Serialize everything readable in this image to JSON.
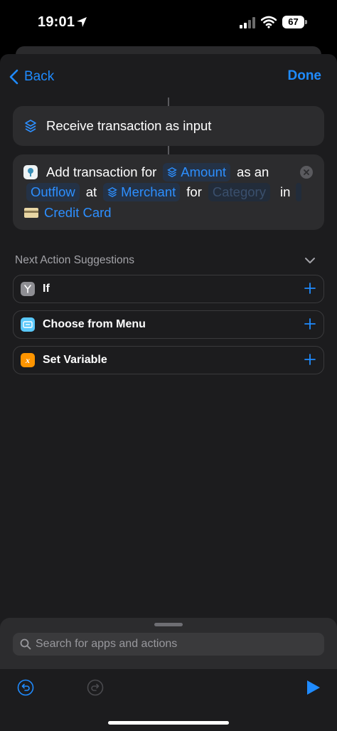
{
  "status": {
    "time": "19:01",
    "battery": "67"
  },
  "nav": {
    "back": "Back",
    "done": "Done"
  },
  "actions": {
    "receive": "Receive transaction as input",
    "add": {
      "w1": "Add transaction for",
      "amount": "Amount",
      "w2": "as an",
      "outflow": "Outflow",
      "w3": "at",
      "merchant": "Merchant",
      "w4": "for",
      "category": "Category",
      "w5": "in",
      "account": "Credit Card"
    }
  },
  "suggestions": {
    "title": "Next Action Suggestions",
    "items": [
      {
        "label": "If",
        "icon": "if-icon",
        "color": "#8e8e93"
      },
      {
        "label": "Choose from Menu",
        "icon": "menu-icon",
        "color": "#5ac8fa"
      },
      {
        "label": "Set Variable",
        "icon": "variable-icon",
        "color": "#ff9500"
      }
    ]
  },
  "search": {
    "placeholder": "Search for apps and actions"
  },
  "colors": {
    "accent": "#1f8bff",
    "background": "#1c1c1e",
    "card": "#2c2c2e"
  }
}
